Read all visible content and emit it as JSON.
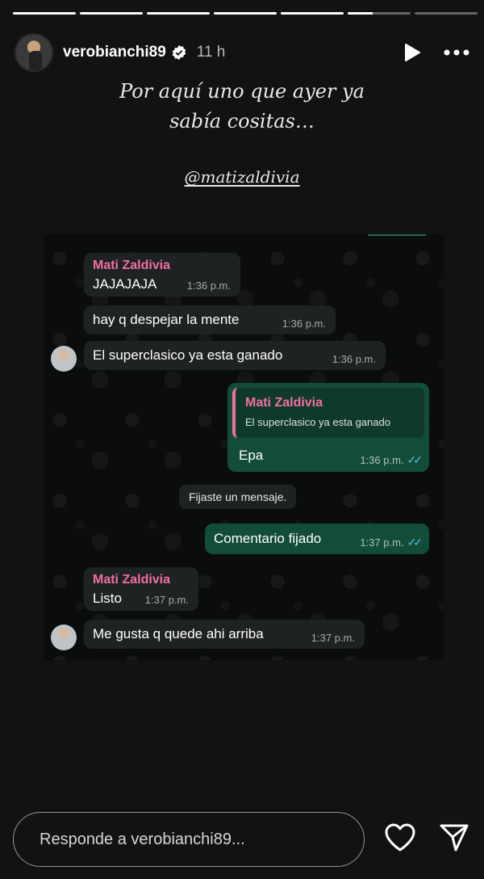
{
  "story": {
    "progress": [
      1,
      1,
      1,
      1,
      1,
      0.4,
      0
    ]
  },
  "header": {
    "username": "verobianchi89",
    "time": "11 h",
    "icons": [
      "verified-badge-icon",
      "play-icon",
      "more-options-icon"
    ]
  },
  "caption": {
    "line1": "Por aquí uno que ayer ya",
    "line2": "sabía cositas…",
    "mention": "@matizaldivia"
  },
  "chat": {
    "messages": [
      {
        "sender": "Mati Zaldivia",
        "text": "JAJAJAJA",
        "time": "1:36 p.m."
      },
      {
        "text": "hay q despejar la mente",
        "time": "1:36 p.m."
      },
      {
        "text": "El superclasico ya esta ganado",
        "time": "1:36 p.m."
      },
      {
        "quote_sender": "Mati Zaldivia",
        "quote_text": "El superclasico ya esta ganado",
        "text": "Epa",
        "time": "1:36 p.m."
      },
      {
        "system": "Fijaste un mensaje."
      },
      {
        "text": "Comentario fijado",
        "time": "1:37 p.m."
      },
      {
        "sender": "Mati Zaldivia",
        "text": "Listo",
        "time": "1:37 p.m."
      },
      {
        "text": "Me gusta q quede ahi arriba",
        "time": "1:37 p.m."
      }
    ],
    "read_receipt_color": "#53bdeb",
    "sender_color": "#f06fa3"
  },
  "reply": {
    "placeholder": "Responde a verobianchi89...",
    "icons": [
      "heart-icon",
      "send-icon"
    ]
  }
}
